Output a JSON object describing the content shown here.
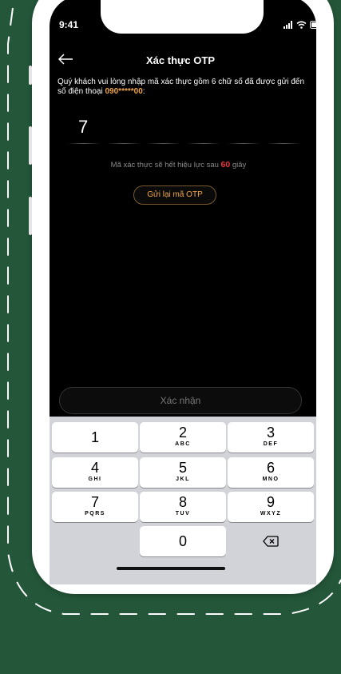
{
  "status_bar": {
    "time": "9:41"
  },
  "header": {
    "title": "Xác thực OTP"
  },
  "instruction": {
    "text": "Quý khách vui lòng nhập mã xác thực gồm 6 chữ số đã được gửi đến số điện thoại ",
    "phone": "090*****00",
    "suffix": ":"
  },
  "otp": {
    "digits": [
      "7",
      "",
      "",
      "",
      "",
      ""
    ]
  },
  "validity": {
    "prefix": "Mã xác thực sẽ hết hiệu lực sau ",
    "seconds": "60",
    "suffix": " giây"
  },
  "resend_button": {
    "label": "Gửi lại mã OTP"
  },
  "confirm_button": {
    "label": "Xác nhận"
  },
  "keypad": {
    "keys": [
      {
        "num": "1",
        "letters": ""
      },
      {
        "num": "2",
        "letters": "ABC"
      },
      {
        "num": "3",
        "letters": "DEF"
      },
      {
        "num": "4",
        "letters": "GHI"
      },
      {
        "num": "5",
        "letters": "JKL"
      },
      {
        "num": "6",
        "letters": "MNO"
      },
      {
        "num": "7",
        "letters": "PQRS"
      },
      {
        "num": "8",
        "letters": "TUV"
      },
      {
        "num": "9",
        "letters": "WXYZ"
      },
      {
        "num": "0",
        "letters": ""
      }
    ]
  },
  "colors": {
    "background": "#24573A",
    "accent": "#F0A64A",
    "timer": "#E8353B"
  }
}
